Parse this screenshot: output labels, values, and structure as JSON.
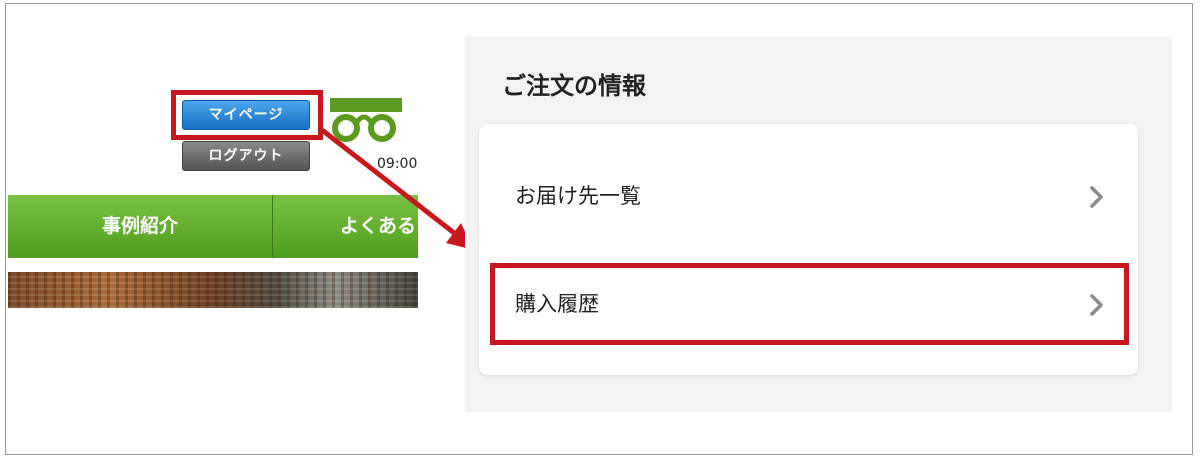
{
  "site_header": {
    "mypage_button": "マイページ",
    "logout_button": "ログアウト",
    "freedial_logo_icon": "freedial-logo-icon",
    "hours_text": "09:00"
  },
  "nav": {
    "items": [
      {
        "label": "事例紹介"
      },
      {
        "label": "よくある"
      }
    ]
  },
  "order_info": {
    "title": "ご注文の情報",
    "items": [
      {
        "label": "お届け先一覧",
        "icon": "chevron-right-icon"
      },
      {
        "label": "購入履歴",
        "icon": "chevron-right-icon"
      }
    ]
  },
  "colors": {
    "highlight": "#c8181e",
    "mypage_button": "#1770c4",
    "logout_button": "#545454",
    "nav_green": "#5aa823",
    "panel_bg": "#f3f3f3",
    "freedial_green": "#5a9a1e"
  }
}
